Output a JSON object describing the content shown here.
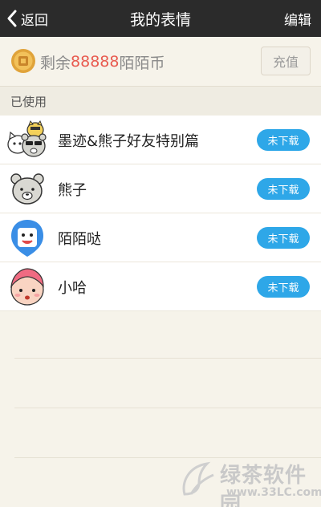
{
  "navbar": {
    "back_label": "返回",
    "title": "我的表情",
    "edit_label": "编辑"
  },
  "balance": {
    "prefix": "剩余",
    "amount": "88888",
    "suffix": "陌陌币",
    "recharge_label": "充值"
  },
  "section": {
    "used_label": "已使用"
  },
  "items": [
    {
      "name": "墨迹&熊子好友特别篇",
      "button": "未下载",
      "icon": "moji-bear-friends-icon"
    },
    {
      "name": "熊子",
      "button": "未下载",
      "icon": "bear-icon"
    },
    {
      "name": "陌陌哒",
      "button": "未下载",
      "icon": "momo-da-icon"
    },
    {
      "name": "小哈",
      "button": "未下载",
      "icon": "xiaoha-icon"
    }
  ],
  "watermark": {
    "text": "绿茶软件园",
    "url": "www.33LC.com"
  },
  "colors": {
    "navbar": "#2b2b2b",
    "accent_amount": "#e85a4f",
    "download_button": "#2ea7e8",
    "background": "#f6f3ea"
  }
}
